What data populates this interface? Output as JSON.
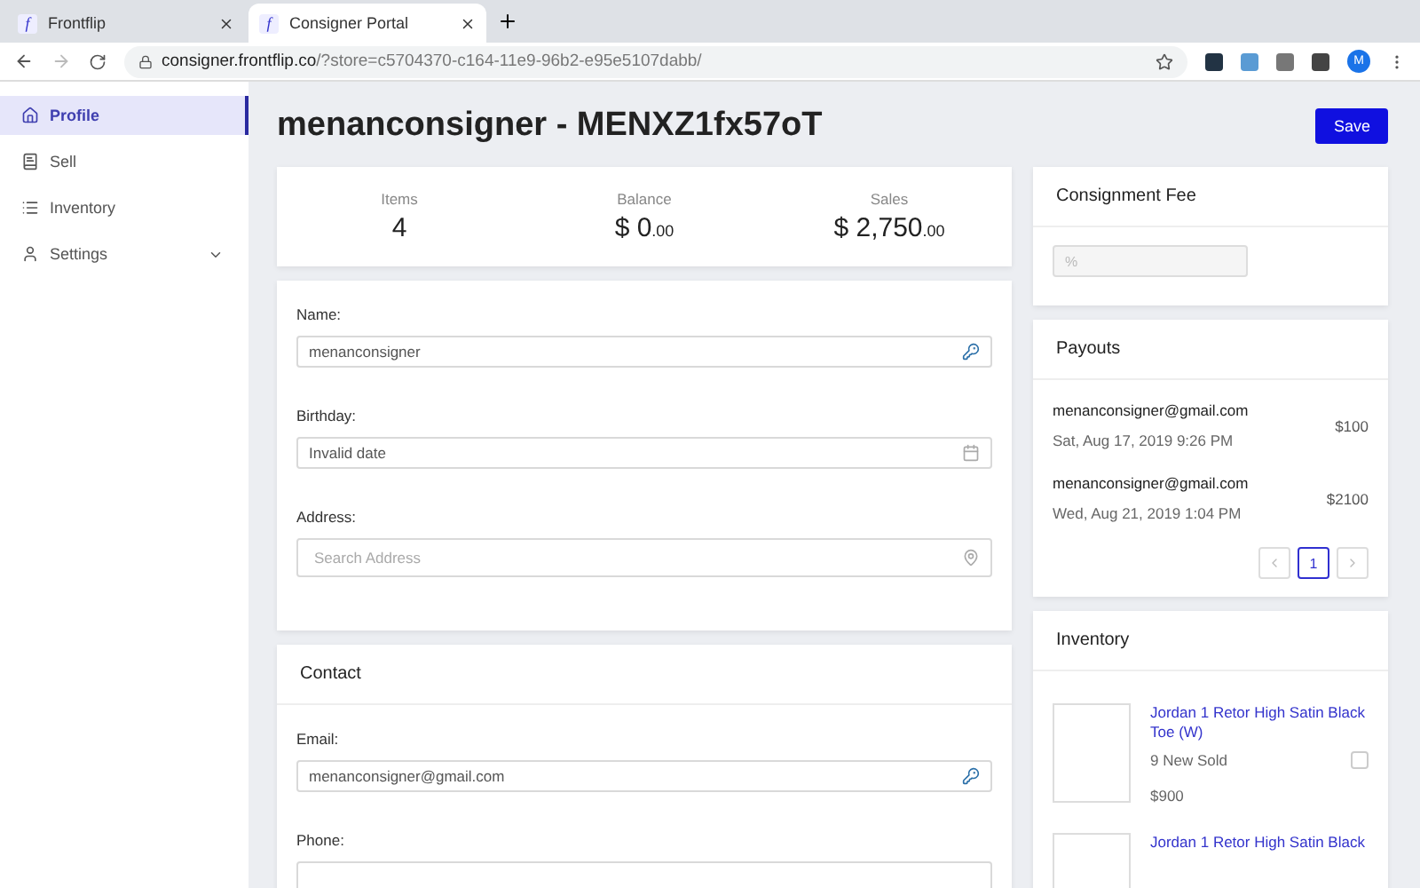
{
  "browser": {
    "tabs": [
      {
        "favicon": "f",
        "title": "Frontflip",
        "selected": false
      },
      {
        "favicon": "f",
        "title": "Consigner Portal",
        "selected": true
      }
    ],
    "url_host": "consigner.frontflip.co",
    "url_path": "/?store=c5704370-c164-11e9-96b2-e95e5107dabb/",
    "avatar": "M"
  },
  "sidebar": {
    "items": [
      {
        "label": "Profile",
        "selected": true,
        "expandable": false
      },
      {
        "label": "Sell",
        "selected": false,
        "expandable": false
      },
      {
        "label": "Inventory",
        "selected": false,
        "expandable": false
      },
      {
        "label": "Settings",
        "selected": false,
        "expandable": true
      }
    ]
  },
  "page": {
    "title": "menanconsigner - MENXZ1fx57oT",
    "save_button": "Save"
  },
  "stats": [
    {
      "label": "Items",
      "amount": "4"
    },
    {
      "label": "Balance",
      "amount": "$ 0",
      "cents": ".00"
    },
    {
      "label": "Sales",
      "amount": "$ 2,750",
      "cents": ".00"
    }
  ],
  "profile_form": {
    "fields": [
      {
        "kind": "text",
        "label": "Name:",
        "value": "menanconsigner"
      },
      {
        "kind": "date",
        "label": "Birthday:",
        "value": "Invalid date"
      },
      {
        "kind": "address",
        "label": "Address:",
        "placeholder": "Search Address"
      }
    ]
  },
  "contact": {
    "title": "Contact",
    "fields": [
      {
        "kind": "text",
        "label": "Email:",
        "value": "menanconsigner@gmail.com"
      },
      {
        "kind": "phone",
        "label": "Phone:"
      }
    ]
  },
  "consignment_fee": {
    "title": "Consignment Fee",
    "placeholder": "%"
  },
  "payouts": {
    "title": "Payouts",
    "items": [
      {
        "email": "menanconsigner@gmail.com",
        "date": "Sat, Aug 17, 2019 9:26 PM",
        "amount": "$100"
      },
      {
        "email": "menanconsigner@gmail.com",
        "date": "Wed, Aug 21, 2019 1:04 PM",
        "amount": "$2100"
      }
    ],
    "pages": [
      {
        "label": "1",
        "selected": true
      }
    ]
  },
  "inventory": {
    "title": "Inventory",
    "items": [
      {
        "name": "Jordan 1 Retor High Satin Black Toe (W)",
        "detail": "9 New Sold",
        "price": "$900",
        "checked": false
      },
      {
        "name": "Jordan 1 Retor High Satin Black"
      }
    ]
  }
}
